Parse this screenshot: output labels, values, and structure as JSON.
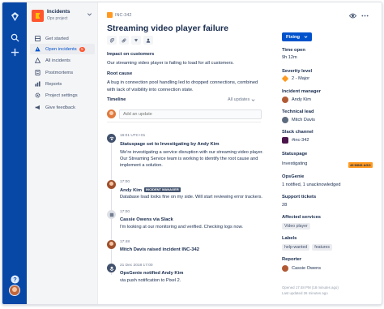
{
  "sidebar": {
    "project_name": "Incidents",
    "project_type": "Ops project",
    "items": [
      {
        "label": "Get started",
        "badge": ""
      },
      {
        "label": "Open incidents",
        "badge": "5"
      },
      {
        "label": "All incidents",
        "badge": ""
      },
      {
        "label": "Postmortems",
        "badge": ""
      },
      {
        "label": "Reports",
        "badge": ""
      },
      {
        "label": "Project settings",
        "badge": ""
      },
      {
        "label": "Give feedback",
        "badge": ""
      }
    ]
  },
  "issue": {
    "key": "INC-342",
    "title": "Streaming video player failure",
    "impact_heading": "Impact on customers",
    "impact_text": "Our streaming video player is failing to load for all customers.",
    "root_heading": "Root cause",
    "root_text": "A bug in connection pool handling led to dropped connections, combined with lack of visibility into connection state."
  },
  "timeline": {
    "heading": "Timeline",
    "filter_label": "All updates",
    "update_placeholder": "Add an update",
    "events": [
      {
        "time": "16:01 UTC+01",
        "title": "Statuspage set to Investigating by Andy Kim",
        "tag": "",
        "body": "We're investigating a service disruption with our streaming video player. Our Streaming Service team is working to identify the root cause and implement a solution."
      },
      {
        "time": "17:00",
        "title": "Andy Kim",
        "tag": "INCIDENT MANAGER",
        "body": "Database load looks fine on my side. Will start reviewing error trackers."
      },
      {
        "time": "17:00",
        "title": "Cassie Owens via Slack",
        "tag": "",
        "body": "I'm looking at our monitoring and verified. Checking logs now."
      },
      {
        "time": "17:48",
        "title": "Mitch Davis raised incident INC-342",
        "tag": "",
        "body": ""
      },
      {
        "time": "21 Dec 2018 17:00",
        "title": "OpsGenie notified Andy Kim",
        "tag": "",
        "body": "via push notification to Pixel 2."
      }
    ]
  },
  "panel": {
    "status_label": "Fixing",
    "fields": [
      {
        "label": "Time open",
        "value": "9h 12m"
      },
      {
        "label": "Severity level",
        "value": "2 - Major"
      },
      {
        "label": "Incident manager",
        "value": "Andy Kim"
      },
      {
        "label": "Technical lead",
        "value": "Mitch Davis"
      },
      {
        "label": "Slack channel",
        "value": "#inc-342"
      },
      {
        "label": "Statuspage",
        "value": "Investigating"
      },
      {
        "label": "OpsGenie",
        "value": "1 notified, 1 unacknowledged"
      },
      {
        "label": "Support tickets",
        "value": "28"
      },
      {
        "label": "Affected services",
        "value": ""
      },
      {
        "label": "Labels",
        "value": ""
      },
      {
        "label": "Reporter",
        "value": "Cassie Owens"
      }
    ],
    "statuspage_badge": "45 MINS AGO",
    "services": [
      "Video player"
    ],
    "labels": [
      "help-wanted",
      "features"
    ],
    "meta_opened": "Opened 17:48 PM (18 minutes ago)",
    "meta_updated": "Last updated 26 minutes ago"
  },
  "colors": {
    "rail": "#0747a6",
    "accent": "#0052cc",
    "badge": "#ff5630",
    "warning": "#ff991f"
  }
}
